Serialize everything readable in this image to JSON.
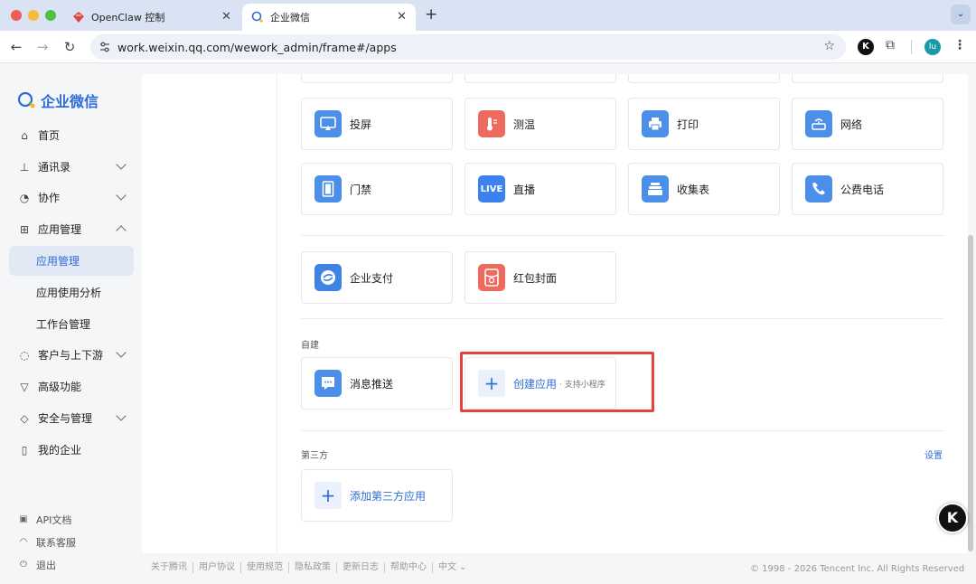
{
  "browser": {
    "tabs": [
      {
        "title": "OpenClaw 控制",
        "active": false
      },
      {
        "title": "企业微信",
        "active": true
      }
    ],
    "url": "work.weixin.qq.com/wework_admin/frame#/apps",
    "profile_initials": "lu",
    "ext_letter": "K"
  },
  "sidebar": {
    "logo_text": "企业微信",
    "items": [
      {
        "label": "首页",
        "icon": "home-icon"
      },
      {
        "label": "通讯录",
        "icon": "org-chart-icon",
        "expandable": true
      },
      {
        "label": "协作",
        "icon": "collab-icon",
        "expandable": true
      },
      {
        "label": "应用管理",
        "icon": "grid-icon",
        "expanded": true
      },
      {
        "label": "应用管理",
        "sub": true,
        "selected": true
      },
      {
        "label": "应用使用分析",
        "sub": true
      },
      {
        "label": "工作台管理",
        "sub": true
      },
      {
        "label": "客户与上下游",
        "icon": "chat-icon",
        "expandable": true
      },
      {
        "label": "高级功能",
        "icon": "diamond-icon"
      },
      {
        "label": "安全与管理",
        "icon": "shield-icon",
        "expandable": true
      },
      {
        "label": "我的企业",
        "icon": "building-icon"
      }
    ],
    "bottom_links": [
      {
        "label": "API文档",
        "icon": "api-icon"
      },
      {
        "label": "联系客服",
        "icon": "headset-icon"
      },
      {
        "label": "退出",
        "icon": "logout-icon"
      }
    ]
  },
  "apps": {
    "row1": [
      {
        "label": "投屏",
        "icon": "screen-cast-icon",
        "color": "#4c8fe8"
      },
      {
        "label": "测温",
        "icon": "thermometer-icon",
        "color": "#ee6a5f"
      },
      {
        "label": "打印",
        "icon": "printer-icon",
        "color": "#4c8fe8"
      },
      {
        "label": "网络",
        "icon": "router-icon",
        "color": "#4c8fe8"
      }
    ],
    "row2": [
      {
        "label": "门禁",
        "icon": "door-icon",
        "color": "#4c8fe8"
      },
      {
        "label": "直播",
        "icon": "live-icon",
        "color": "#3b82f0",
        "badge": "LIVE"
      },
      {
        "label": "收集表",
        "icon": "inbox-icon",
        "color": "#4c8fe8"
      },
      {
        "label": "公费电话",
        "icon": "phone-icon",
        "color": "#4c8fe8"
      }
    ],
    "row3": [
      {
        "label": "企业支付",
        "icon": "pay-icon",
        "color": "#3f84e5"
      },
      {
        "label": "红包封面",
        "icon": "red-envelope-icon",
        "color": "#ee6a5f"
      }
    ],
    "self_built": {
      "section_label": "自建",
      "items": [
        {
          "label": "消息推送",
          "icon": "message-push-icon",
          "color": "#4c8fe8"
        }
      ],
      "create_label": "创建应用",
      "create_hint": "· 支持小程序"
    },
    "third_party": {
      "section_label": "第三方",
      "settings_label": "设置",
      "add_label": "添加第三方应用"
    }
  },
  "footer": {
    "links": [
      "关于腾讯",
      "用户协议",
      "使用规范",
      "隐私政策",
      "更新日志",
      "帮助中心",
      "中文 ⌄"
    ],
    "copyright": "© 1998 - 2026 Tencent Inc. All Rights Reserved"
  },
  "floating_badge": "K"
}
